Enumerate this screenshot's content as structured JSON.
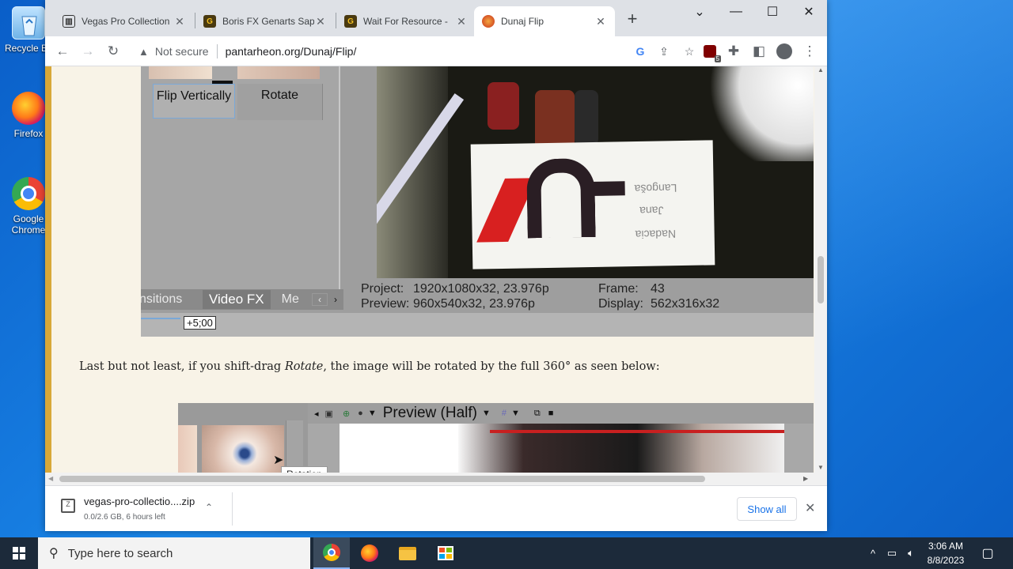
{
  "desktop": {
    "icons": [
      {
        "label": "Recycle Bin"
      },
      {
        "label": "Firefox"
      },
      {
        "label": "Google Chrome"
      }
    ]
  },
  "browser": {
    "tabs": [
      {
        "label": "Vegas Pro Collection",
        "icon": "vegas-icon",
        "active": false
      },
      {
        "label": "Boris FX Genarts Sapphire",
        "icon": "g-icon",
        "active": false
      },
      {
        "label": "Wait For Resource - ",
        "icon": "g-icon",
        "active": false
      },
      {
        "label": "Dunaj Flip",
        "icon": "dunaj-icon",
        "active": true
      }
    ],
    "new_tab": "+",
    "window_controls": {
      "list": "⌄",
      "minimize": "—",
      "maximize": "☐",
      "close": "✕"
    },
    "security": "Not secure",
    "url": "pantarheon.org/Dunaj/Flip/",
    "extension_badge": "5"
  },
  "page": {
    "vegas_top": {
      "thumb_labels": [
        "Flip Vertically",
        "Rotate"
      ],
      "tabs": [
        "nsitions",
        "Video FX",
        "Me"
      ],
      "project_label": "Project:",
      "project_value": "1920x1080x32, 23.976p",
      "preview_label": "Preview:",
      "preview_value": "960x540x32, 23.976p",
      "frame_label": "Frame:",
      "frame_value": "43",
      "display_label": "Display:",
      "display_value": "562x316x32",
      "timecode": "+5;00",
      "sign_lines": [
        "Langoša",
        "Jana",
        "Nadacia"
      ]
    },
    "paragraph": {
      "before": "Last but not least, if you shift-drag ",
      "emph": "Rotate",
      "after": ", the image will be rotated by the full 360° as seen below:"
    },
    "vegas_bottom": {
      "preview_title": "Preview (Half)",
      "tooltip": "Rotation"
    }
  },
  "downloads": {
    "file_name": "vegas-pro-collectio....zip",
    "status": "0.0/2.6 GB, 6 hours left",
    "show_all": "Show all"
  },
  "taskbar": {
    "search_placeholder": "Type here to search",
    "time": "3:06 AM",
    "date": "8/8/2023"
  },
  "colors": {
    "page_bg": "#f8f3e7",
    "gold_bar": "#d8a838",
    "vegas_gray": "#a8a8a8",
    "taskbar": "#1c2a3a"
  }
}
